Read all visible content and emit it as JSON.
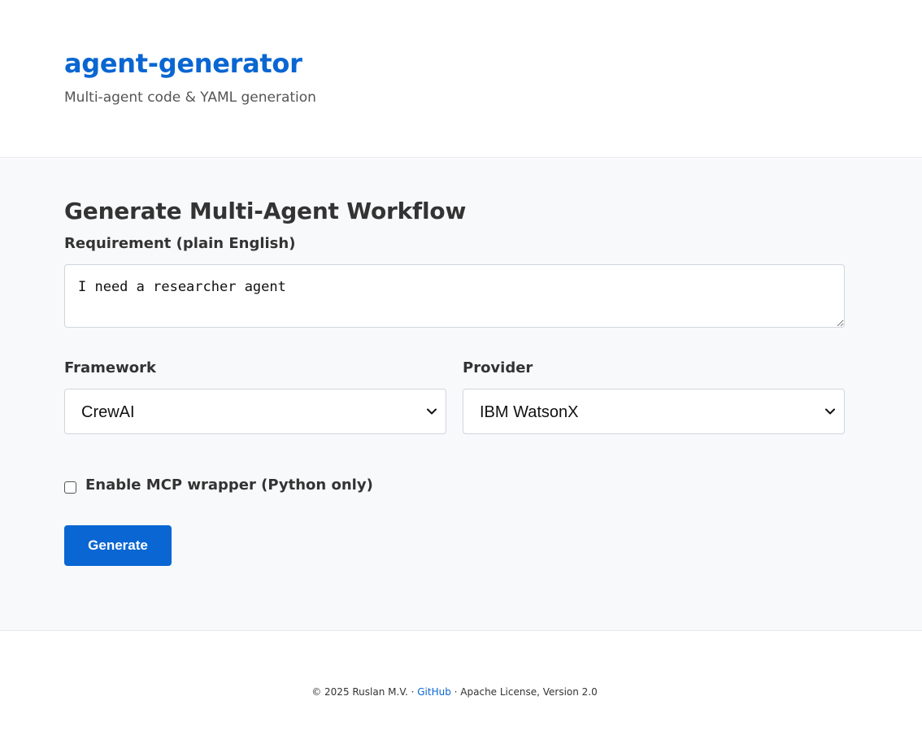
{
  "header": {
    "title": "agent-generator",
    "subtitle": "Multi-agent code & YAML generation"
  },
  "form": {
    "heading": "Generate Multi-Agent Workflow",
    "requirement_label": "Requirement (plain English)",
    "requirement_value": "I need a researcher agent",
    "framework_label": "Framework",
    "framework_value": "CrewAI",
    "provider_label": "Provider",
    "provider_value": "IBM WatsonX",
    "mcp_label": "Enable MCP wrapper (Python only)",
    "mcp_checked": false,
    "generate_label": "Generate"
  },
  "footer": {
    "copyright": "© 2025 Ruslan M.V. · ",
    "github_label": "GitHub",
    "license": " · Apache License, Version 2.0"
  },
  "colors": {
    "accent": "#0966d2",
    "section_bg": "#f8f9fb"
  },
  "icons": {
    "select_chevron": "chevron-down-icon"
  }
}
